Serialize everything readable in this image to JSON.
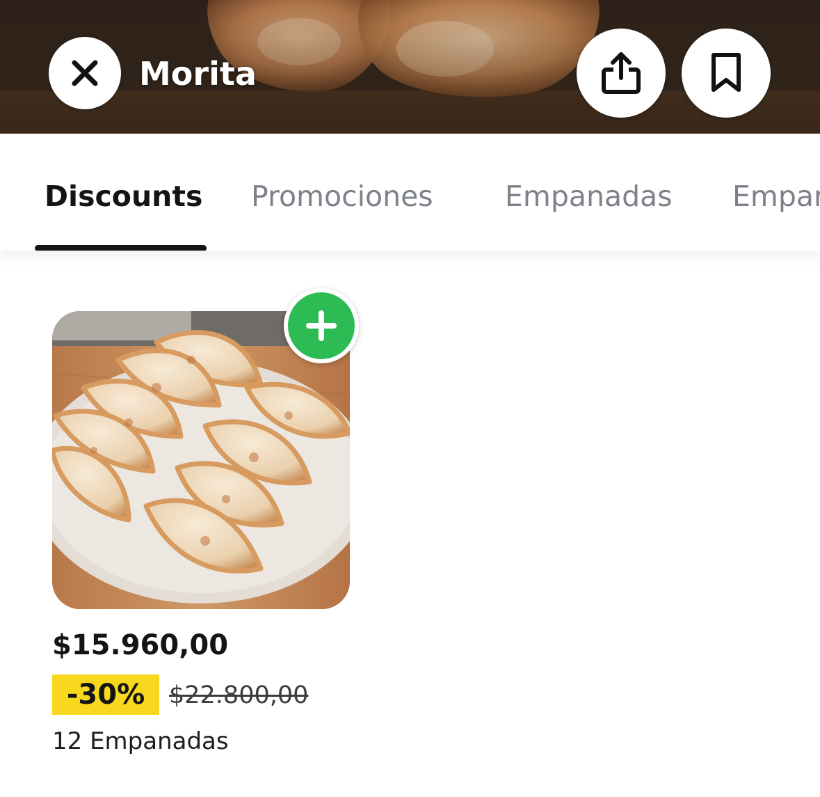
{
  "header": {
    "store_name": "Morita",
    "close_icon": "close-icon",
    "share_icon": "share-icon",
    "bookmark_icon": "bookmark-icon"
  },
  "tabs": [
    {
      "label": "Discounts",
      "active": true
    },
    {
      "label": "Promociones",
      "active": false
    },
    {
      "label": "Empanadas",
      "active": false
    },
    {
      "label": "Empar",
      "active": false
    }
  ],
  "products": [
    {
      "price": "$15.960,00",
      "discount": "-30%",
      "original_price": "$22.800,00",
      "name": "12 Empanadas",
      "add_icon": "plus-icon"
    }
  ],
  "colors": {
    "add_button": "#2dbb54",
    "discount_badge": "#f8d81e",
    "active_tab": "#141414",
    "inactive_tab": "#7d828a"
  }
}
